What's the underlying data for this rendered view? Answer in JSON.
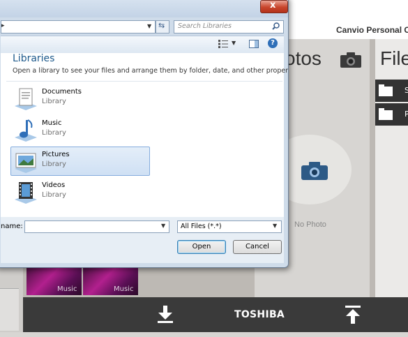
{
  "app": {
    "title": "Canvio Personal Cl",
    "photos_title": "otos",
    "files_title": "File",
    "no_photo": "No Photo",
    "files_rows": [
      {
        "label": "S"
      },
      {
        "label": "P"
      }
    ],
    "music_thumbs": [
      {
        "label": "Music"
      },
      {
        "label": "Music"
      }
    ],
    "brand": "TOSHIBA"
  },
  "dialog": {
    "search_placeholder": "Search Libraries",
    "libraries_title": "Libraries",
    "libraries_desc": "Open a library to see your files and arrange them by folder, date, and other properties.",
    "items": [
      {
        "name": "Documents",
        "sub": "Library",
        "icon": "documents-library-icon",
        "selected": false
      },
      {
        "name": "Music",
        "sub": "Library",
        "icon": "music-library-icon",
        "selected": false
      },
      {
        "name": "Pictures",
        "sub": "Library",
        "icon": "pictures-library-icon",
        "selected": true
      },
      {
        "name": "Videos",
        "sub": "Library",
        "icon": "videos-library-icon",
        "selected": false
      }
    ],
    "filename_label": "name:",
    "filename_value": "",
    "filetype_value": "All Files (*.*)",
    "open_label": "Open",
    "cancel_label": "Cancel",
    "close_label": "x"
  }
}
